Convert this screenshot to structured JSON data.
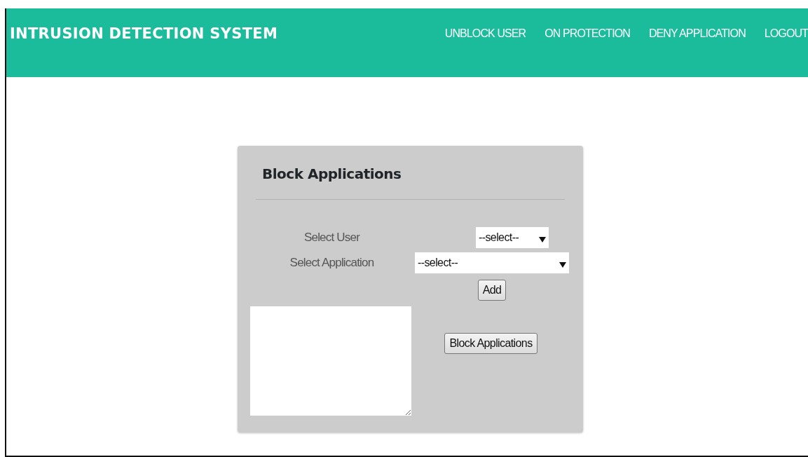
{
  "navbar": {
    "brand": "INTRUSION DETECTION SYSTEM",
    "links": [
      {
        "label": "UNBLOCK USER"
      },
      {
        "label": "ON PROTECTION"
      },
      {
        "label": "DENY APPLICATION"
      },
      {
        "label": "LOGOUT"
      }
    ]
  },
  "panel": {
    "title": "Block Applications",
    "fields": [
      {
        "label": "Select User",
        "value": "--select--",
        "kind": "short"
      },
      {
        "label": "Select Application",
        "value": "--select--",
        "kind": "wide"
      }
    ],
    "add_button": "Add",
    "submit_button": "Block Applications"
  }
}
